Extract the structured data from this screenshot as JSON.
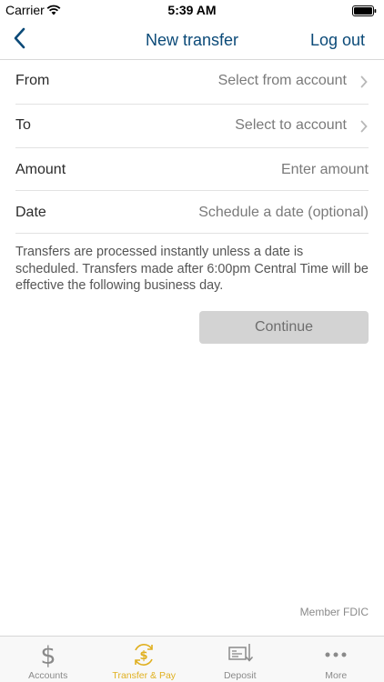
{
  "status_bar": {
    "carrier": "Carrier",
    "time": "5:39 AM"
  },
  "nav": {
    "title": "New transfer",
    "logout_label": "Log out"
  },
  "form": {
    "from": {
      "label": "From",
      "value": "Select from account"
    },
    "to": {
      "label": "To",
      "value": "Select to account"
    },
    "amount": {
      "label": "Amount",
      "placeholder": "Enter amount"
    },
    "date": {
      "label": "Date",
      "placeholder": "Schedule a date (optional)"
    }
  },
  "info_text": "Transfers are processed instantly unless a date is scheduled. Transfers made after 6:00pm Central Time will be effective the following business day.",
  "continue_label": "Continue",
  "footer": {
    "fdic": "Member FDIC"
  },
  "tabs": [
    {
      "label": "Accounts",
      "icon": "dollar-icon",
      "active": false
    },
    {
      "label": "Transfer & Pay",
      "icon": "transfer-pay-icon",
      "active": true
    },
    {
      "label": "Deposit",
      "icon": "check-deposit-icon",
      "active": false
    },
    {
      "label": "More",
      "icon": "more-dots-icon",
      "active": false
    }
  ],
  "colors": {
    "accent": "#0b4a78",
    "active_tab": "#e0b020",
    "button_disabled": "#d3d3d3"
  }
}
